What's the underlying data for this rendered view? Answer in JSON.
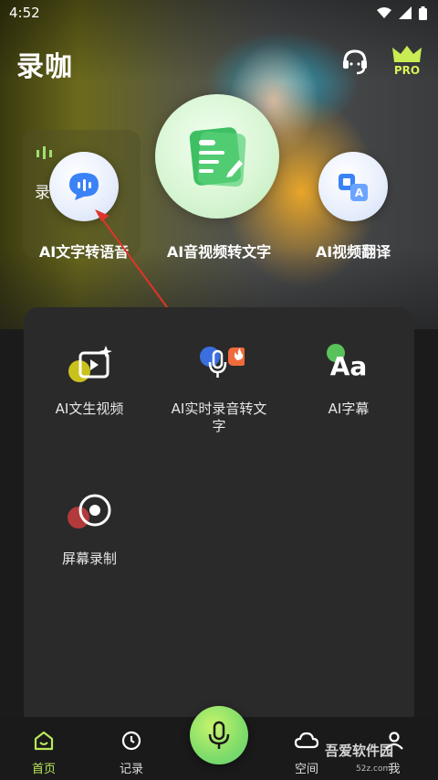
{
  "status_bar": {
    "time": "4:52"
  },
  "header": {
    "title": "录咖",
    "pro_label": "PRO"
  },
  "hero": {
    "record_card_label": "录",
    "features": [
      {
        "label": "AI文字转语音"
      },
      {
        "label": "AI音视频转文字"
      },
      {
        "label": "AI视频翻译"
      }
    ]
  },
  "panel": {
    "tools": [
      {
        "label": "AI文生视频"
      },
      {
        "label": "AI实时录音转文字"
      },
      {
        "label": "AI字幕",
        "icon_text": "Aa"
      },
      {
        "label": "屏幕录制"
      }
    ]
  },
  "bottom_nav": {
    "items": [
      {
        "label": "首页"
      },
      {
        "label": "记录"
      },
      {
        "label": "空间"
      },
      {
        "label": "我"
      }
    ]
  },
  "watermark": {
    "text": "吾爱软件园",
    "sub": "52z.com"
  },
  "colors": {
    "accent": "#b9e85a",
    "panel": "#2a2a2a",
    "arrow": "#e0332a"
  }
}
